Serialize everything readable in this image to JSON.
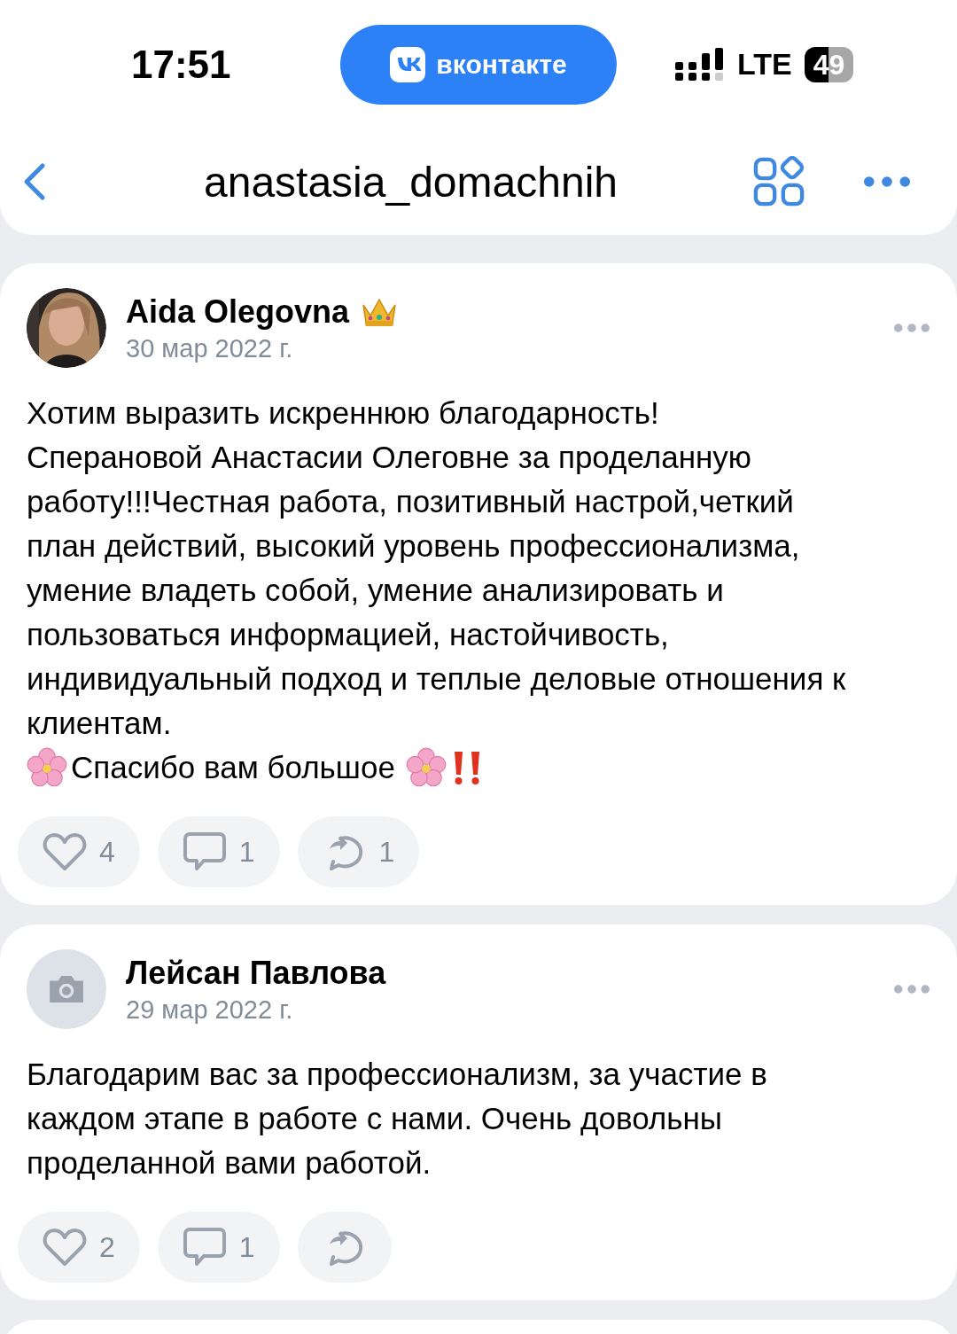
{
  "status_bar": {
    "time": "17:51",
    "app_pill": "вконтакте",
    "network": "LTE",
    "battery": "49"
  },
  "header": {
    "title": "anastasia_domachnih"
  },
  "posts": [
    {
      "author": "Aida Olegovna",
      "badge": {
        "kind": "crown"
      },
      "date": "30 мар 2022 г.",
      "text": "Хотим выразить искреннюю благодарность!\nСперановой Анастасии Олеговне за проделанную\nработу!!!Честная работа, позитивный настрой,четкий\nплан действий, высокий уровень профессионализма,\nумение владеть собой, умение анализировать и\nпользоваться информацией, настойчивость,\nиндивидуальный подход и теплые деловые отношения к\nклиентам.",
      "closing": "Спасибо вам большое",
      "likes": "4",
      "comments": "1",
      "shares": "1"
    },
    {
      "author": "Лейсан Павлова",
      "avatar": {
        "kind": "placeholder"
      },
      "date": "29 мар 2022 г.",
      "text": "Благодарим вас за профессионализм, за участие в\nкаждом этапе в работе с нами. Очень довольны\nпроделанной вами работой.",
      "likes": "2",
      "comments": "1"
    }
  ]
}
